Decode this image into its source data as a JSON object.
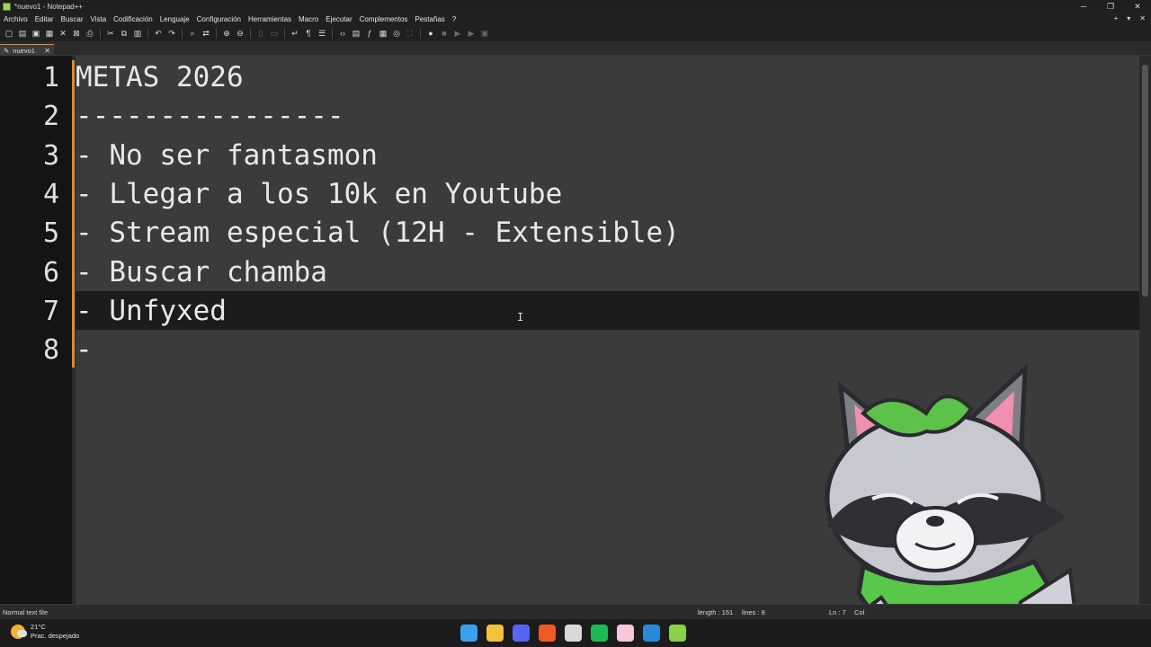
{
  "window": {
    "title": "*nuevo1 - Notepad++",
    "controls": [
      "─",
      "❐",
      "✕"
    ]
  },
  "menu": {
    "items": [
      "Archivo",
      "Editar",
      "Buscar",
      "Vista",
      "Codificación",
      "Lenguaje",
      "Configuración",
      "Herramientas",
      "Macro",
      "Ejecutar",
      "Complementos",
      "Pestañas",
      "?"
    ],
    "right": [
      "+",
      "▾",
      "✕"
    ]
  },
  "toolbar": {
    "icons": [
      "new-file-icon",
      "open-file-icon",
      "save-icon",
      "save-all-icon",
      "close-icon",
      "close-all-icon",
      "print-icon",
      "cut-icon",
      "copy-icon",
      "paste-icon",
      "undo-icon",
      "redo-icon",
      "find-icon",
      "replace-icon",
      "zoom-in-icon",
      "zoom-out-icon",
      "sync-v-icon",
      "sync-h-icon",
      "word-wrap-icon",
      "show-all-chars-icon",
      "indent-guide-icon",
      "xml-icon",
      "doc-map-icon",
      "function-list-icon",
      "folder-workspace-icon",
      "monitoring-icon",
      "fullscreen-icon",
      "record-macro-icon",
      "stop-macro-icon",
      "play-macro-icon",
      "run-macro-icon",
      "save-macro-icon"
    ]
  },
  "tab": {
    "label": "nuevo1",
    "close": "✕"
  },
  "editor": {
    "line_numbers": [
      "1",
      "2",
      "3",
      "4",
      "5",
      "6",
      "7",
      "8"
    ],
    "lines": [
      "METAS 2026",
      "----------------",
      "- No ser fantasmon",
      "- Llegar a los 10k en Youtube",
      "- Stream especial (12H - Extensible)",
      "- Buscar chamba",
      "- Unfyxed",
      "-"
    ],
    "current_line_index": 7
  },
  "status": {
    "file_type": "Normal text file",
    "length": "length : 151",
    "lines": "lines : 8",
    "ln": "Ln : 7",
    "col": "Col"
  },
  "taskbar": {
    "weather_temp": "21°C",
    "weather_desc": "Prac. despejado",
    "apps": [
      {
        "name": "windows-start-icon",
        "color": "#3aa0f0"
      },
      {
        "name": "file-explorer-icon",
        "color": "#f3c13a"
      },
      {
        "name": "discord-icon",
        "color": "#5865f2"
      },
      {
        "name": "brave-icon",
        "color": "#f05a24"
      },
      {
        "name": "obs-icon",
        "color": "#d9d9d9"
      },
      {
        "name": "spotify-icon",
        "color": "#1db954"
      },
      {
        "name": "app-pink-icon",
        "color": "#f6c7d8"
      },
      {
        "name": "paint-icon",
        "color": "#2b88d8"
      },
      {
        "name": "notepadpp-icon",
        "color": "#8bcf4a"
      }
    ]
  },
  "accent": "#e58a1f"
}
